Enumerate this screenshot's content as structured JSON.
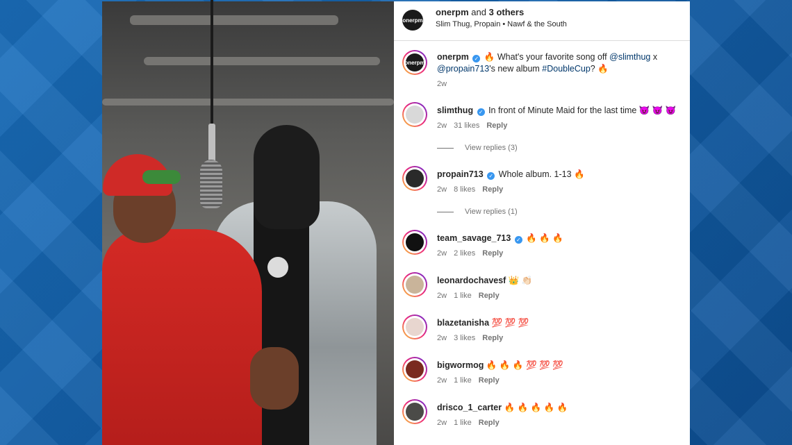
{
  "header": {
    "account": "onerpm",
    "others_prefix": "and",
    "others": "3 others",
    "subtitle": "Slim Thug, Propain • Nawf & the South",
    "avatar_text": "onerpm"
  },
  "caption": {
    "user": "onerpm",
    "text_before": "🔥 What's your favorite song off ",
    "mention1": "@slimthug",
    "x": " x",
    "mention2": "@propain713",
    "text_middle": "'s new album ",
    "hashtag": "#DoubleCup",
    "text_after": "? 🔥",
    "time": "2w"
  },
  "comments": [
    {
      "user": "slimthug",
      "verified": true,
      "text": "In front of Minute Maid for the last time 😈 😈 😈",
      "time": "2w",
      "likes": "31 likes",
      "reply": "Reply",
      "view_replies": "View replies (3)",
      "avatar_color": "#d9d9d9"
    },
    {
      "user": "propain713",
      "verified": true,
      "text": "Whole album. 1-13 🔥",
      "time": "2w",
      "likes": "8 likes",
      "reply": "Reply",
      "view_replies": "View replies (1)",
      "avatar_color": "#2a2a2a"
    },
    {
      "user": "team_savage_713",
      "verified": true,
      "text": "🔥 🔥 🔥",
      "time": "2w",
      "likes": "2 likes",
      "reply": "Reply",
      "avatar_color": "#111111"
    },
    {
      "user": "leonardochavesf",
      "verified": false,
      "text": "👑 👏🏻",
      "time": "2w",
      "likes": "1 like",
      "reply": "Reply",
      "avatar_color": "#c9b49a"
    },
    {
      "user": "blazetanisha",
      "verified": false,
      "text": "💯 💯 💯",
      "time": "2w",
      "likes": "3 likes",
      "reply": "Reply",
      "avatar_color": "#e8d6cf"
    },
    {
      "user": "bigwormog",
      "verified": false,
      "text": "🔥 🔥 🔥 💯 💯 💯",
      "time": "2w",
      "likes": "1 like",
      "reply": "Reply",
      "avatar_color": "#7a2a1f"
    },
    {
      "user": "drisco_1_carter",
      "verified": false,
      "text": "🔥 🔥 🔥 🔥 🔥",
      "time": "2w",
      "likes": "1 like",
      "reply": "Reply",
      "avatar_color": "#4b4b48"
    }
  ],
  "colors": {
    "background": "#1565ad",
    "panel": "#ffffff",
    "text": "#262626",
    "muted": "#737373",
    "link": "#00376b",
    "verified": "#3897f0"
  }
}
